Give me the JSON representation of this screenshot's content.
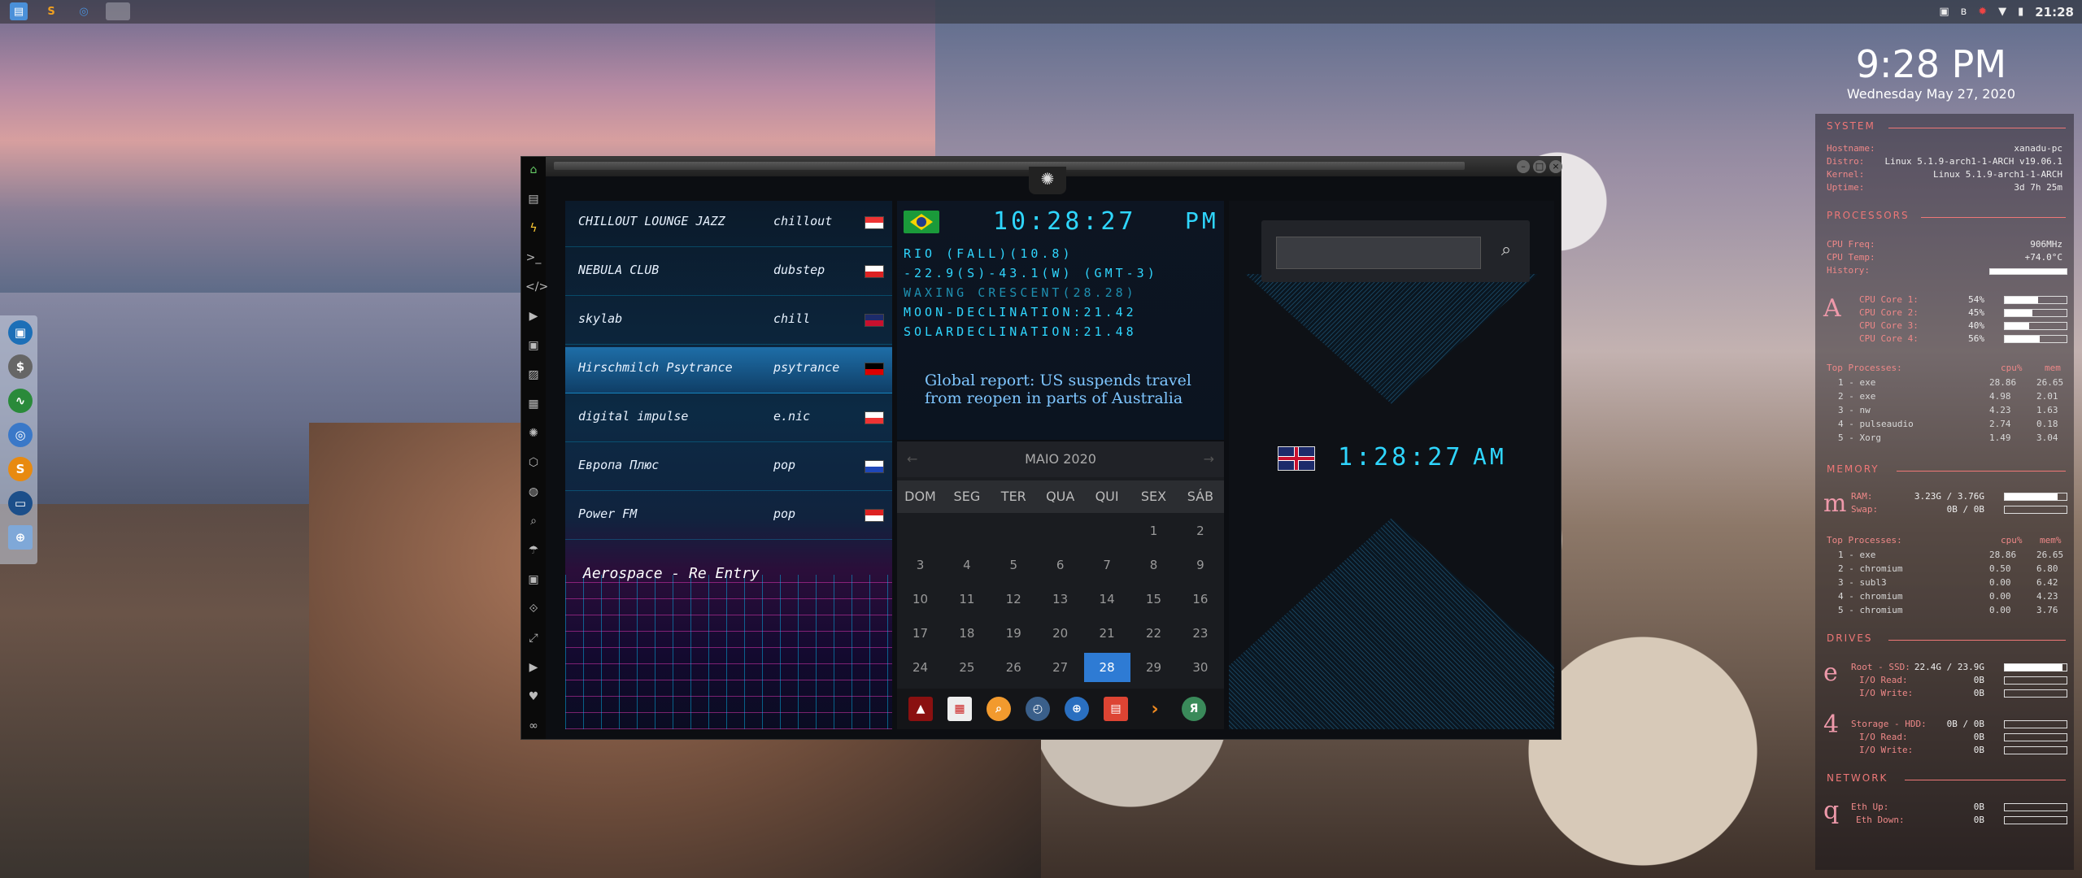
{
  "topbar": {
    "clock": "21:28",
    "apps": [
      "files-icon",
      "sublime-icon",
      "chromium-icon",
      "workspace-icon"
    ]
  },
  "desktop_clock": {
    "time": "9:28 PM",
    "date": "Wednesday May 27, 2020"
  },
  "dock": {
    "items": [
      "browser-icon",
      "money-icon",
      "activity-icon",
      "chromium-icon",
      "s-app-icon",
      "remote-icon",
      "globe-icon"
    ]
  },
  "window": {
    "radio": {
      "stations": [
        {
          "name": "CHILLOUT LOUNGE JAZZ",
          "genre": "chillout"
        },
        {
          "name": "NEBULA CLUB",
          "genre": "dubstep"
        },
        {
          "name": "skylab",
          "genre": "chill"
        },
        {
          "name": "Hirschmilch Psytrance",
          "genre": "psytrance"
        },
        {
          "name": "digital impulse",
          "genre": "e.nic"
        },
        {
          "name": "Европа Плюс",
          "genre": "pop"
        },
        {
          "name": "Power FM",
          "genre": "pop"
        }
      ],
      "now_playing": "Aerospace - Re Entry"
    },
    "info": {
      "time": "10:28:27",
      "ampm": "PM",
      "lines": [
        "RIO (FALL)(10.8)",
        "-22.9(S)-43.1(W) (GMT-3)",
        "WAXING CRESCENT(28.28)",
        "MOON-DECLINATION:21.42",
        "SOLARDECLINATION:21.48"
      ],
      "news": "Global report: US suspends travel from reopen in parts of Australia"
    },
    "calendar": {
      "title": "MAIO 2020",
      "prev": "←",
      "next": "→",
      "weekdays": [
        "DOM",
        "SEG",
        "TER",
        "QUA",
        "QUI",
        "SEX",
        "SÁB"
      ],
      "weeks": [
        [
          "",
          "",
          "",
          "",
          "",
          "1",
          "2"
        ],
        [
          "3",
          "4",
          "5",
          "6",
          "7",
          "8",
          "9"
        ],
        [
          "10",
          "11",
          "12",
          "13",
          "14",
          "15",
          "16"
        ],
        [
          "17",
          "18",
          "19",
          "20",
          "21",
          "22",
          "23"
        ],
        [
          "24",
          "25",
          "26",
          "27",
          "28",
          "29",
          "30"
        ]
      ],
      "today": "28"
    },
    "right": {
      "search_placeholder": "",
      "time": "1:28:27",
      "ampm": "AM"
    }
  },
  "conky": {
    "system": {
      "title": "SYSTEM",
      "rows": [
        {
          "k": "Hostname:",
          "v": "xanadu-pc"
        },
        {
          "k": "Distro:",
          "v": "Linux 5.1.9-arch1-1-ARCH v19.06.1"
        },
        {
          "k": "Kernel:",
          "v": "Linux 5.1.9-arch1-1-ARCH"
        },
        {
          "k": "Uptime:",
          "v": "3d 7h 25m"
        }
      ]
    },
    "processors": {
      "title": "PROCESSORS",
      "freq_label": "CPU Freq:",
      "freq": "906MHz",
      "temp_label": "CPU Temp:",
      "temp": "+74.0°C",
      "history_label": "History:",
      "letter": "A",
      "cores": [
        {
          "k": "CPU Core 1:",
          "v": "54%",
          "p": 0.54
        },
        {
          "k": "CPU Core 2:",
          "v": "45%",
          "p": 0.45
        },
        {
          "k": "CPU Core 3:",
          "v": "40%",
          "p": 0.4
        },
        {
          "k": "CPU Core 4:",
          "v": "56%",
          "p": 0.56
        }
      ],
      "top_label": "Top Processes:",
      "col1": "cpu%",
      "col2": "mem",
      "procs": [
        {
          "n": "1 - exe",
          "a": "28.86",
          "b": "26.65"
        },
        {
          "n": "2 - exe",
          "a": "4.98",
          "b": "2.01"
        },
        {
          "n": "3 - nw",
          "a": "4.23",
          "b": "1.63"
        },
        {
          "n": "4 - pulseaudio",
          "a": "2.74",
          "b": "0.18"
        },
        {
          "n": "5 - Xorg",
          "a": "1.49",
          "b": "3.04"
        }
      ]
    },
    "memory": {
      "title": "MEMORY",
      "letter": "m",
      "ram_label": "RAM:",
      "ram": "3.23G / 3.76G",
      "ram_p": 0.86,
      "swap_label": "Swap:",
      "swap": "0B / 0B",
      "swap_p": 0,
      "top_label": "Top Processes:",
      "col1": "cpu%",
      "col2": "mem%",
      "procs": [
        {
          "n": "1 - exe",
          "a": "28.86",
          "b": "26.65"
        },
        {
          "n": "2 - chromium",
          "a": "0.50",
          "b": "6.80"
        },
        {
          "n": "3 - subl3",
          "a": "0.00",
          "b": "6.42"
        },
        {
          "n": "4 - chromium",
          "a": "0.00",
          "b": "4.23"
        },
        {
          "n": "5 - chromium",
          "a": "0.00",
          "b": "3.76"
        }
      ]
    },
    "drives": {
      "title": "DRIVES",
      "d1_letter": "e",
      "d1": {
        "k": "Root - SSD:",
        "v": "22.4G / 23.9G",
        "p": 0.94,
        "r_label": "I/O Read:",
        "r": "0B",
        "w_label": "I/O Write:",
        "w": "0B"
      },
      "d2_letter": "4",
      "d2": {
        "k": "Storage - HDD:",
        "v": "0B / 0B",
        "p": 0,
        "r_label": "I/O Read:",
        "r": "0B",
        "w_label": "I/O Write:",
        "w": "0B"
      }
    },
    "network": {
      "title": "NETWORK",
      "letter": "q",
      "up_label": "Eth Up:",
      "up": "0B",
      "down_label": "Eth Down:",
      "down": "0B"
    }
  },
  "colors": {
    "accent": "#2fd6ff",
    "conky_red": "#e77777",
    "today": "#2e7bd4"
  }
}
